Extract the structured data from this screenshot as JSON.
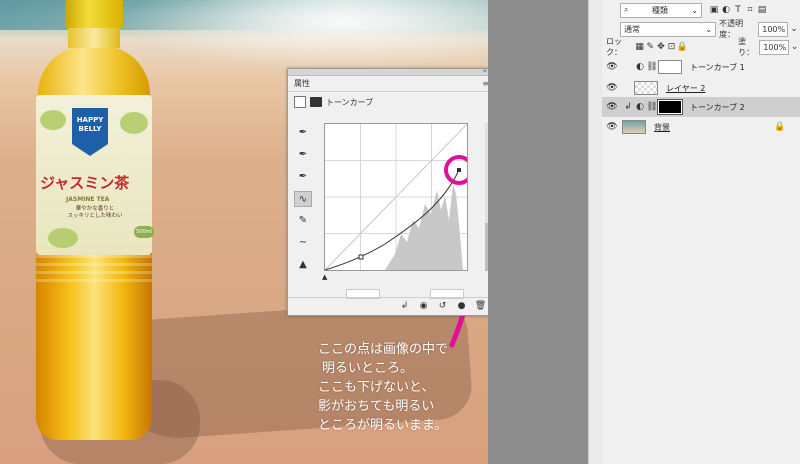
{
  "canvas": {
    "bottle": {
      "brand": "HAPPY BELLY",
      "product": "ジャスミン茶",
      "subtitle": "JASMINE TEA",
      "description": [
        "華やかな香りと",
        "スッキリとした味わい"
      ],
      "volume": "500ml"
    }
  },
  "properties_panel": {
    "title": "属性",
    "adjustment_label": "トーンカーブ",
    "histogram_color": "#c8c8c8",
    "curve_color": "#333333",
    "highlight_color": "#e0109a"
  },
  "annotation": {
    "lines": [
      "ここの点は画像の中で",
      "明るいところ。",
      "ここも下げないと、",
      "影がおちても明るい",
      "ところが明るいまま。"
    ],
    "color": "#e0109a"
  },
  "layers_panel": {
    "filter_kind": "種類",
    "blend_mode": "通常",
    "opacity_label": "不透明度：",
    "opacity_value": "100%",
    "lock_label": "ロック：",
    "fill_label": "塗り：",
    "fill_value": "100%",
    "layers": [
      {
        "name": "トーンカーブ 1",
        "type": "adjustment"
      },
      {
        "name": "レイヤー 2",
        "type": "pixel"
      },
      {
        "name": "トーンカーブ 2",
        "type": "adjustment-masked"
      },
      {
        "name": "背景",
        "type": "background"
      }
    ]
  }
}
